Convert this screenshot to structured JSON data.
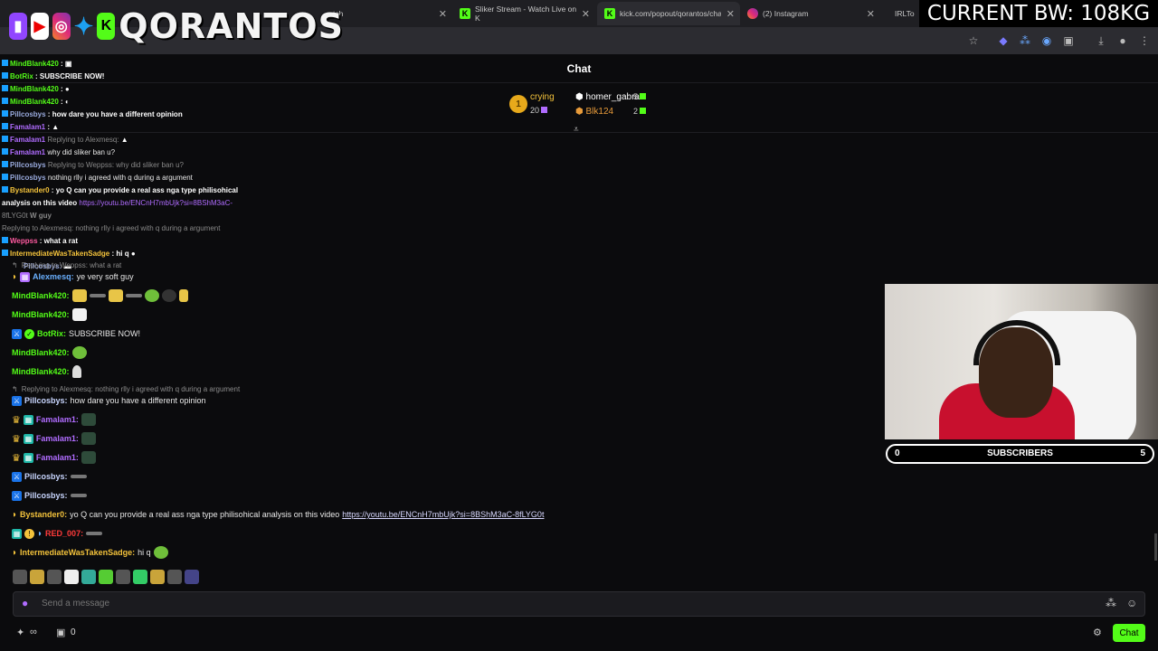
{
  "browser": {
    "tabs": [
      {
        "label": "tch",
        "favicon": "twitch-icon"
      },
      {
        "label": "Sliker Stream - Watch Live on K",
        "favicon": "kick-icon"
      },
      {
        "label": "kick.com/popout/qorantos/cha",
        "favicon": "kick-icon"
      },
      {
        "label": "(2) Instagram",
        "favicon": "instagram-icon"
      },
      {
        "label": "IRLTo",
        "favicon": "irl-icon"
      }
    ]
  },
  "overlay": {
    "channel_name": "QORANTOS",
    "bw_banner": "CURRENT BW: 108KG",
    "small_chat": [
      {
        "user": "MindBlank420",
        "text": ""
      },
      {
        "user": "BotRix",
        "text": "SUBSCRIBE NOW!"
      },
      {
        "user": "MindBlank420",
        "text": ""
      },
      {
        "user": "MindBlank420",
        "text": ""
      },
      {
        "user": "Pillcosbys",
        "text": "how dare you have a different opinion"
      },
      {
        "user": "Famalam1",
        "text": ""
      },
      {
        "user": "Famalam1",
        "text": ""
      },
      {
        "user": "Famalam1",
        "text": ""
      },
      {
        "user": "Pillcosbys",
        "text": ""
      },
      {
        "user": "Pillcosbys",
        "text": ""
      },
      {
        "user": "Bystander0",
        "text": "yo Q can you provide a real ass nga type philisohical"
      },
      {
        "user": "",
        "text": "W guy"
      },
      {
        "user": "",
        "text": ""
      },
      {
        "user": "IntermediateWasTakenSadge",
        "text": "hi q"
      }
    ]
  },
  "chat": {
    "title": "Chat",
    "leaderboard": {
      "first_place": "1",
      "first_name": "crying",
      "first_count": "20",
      "second_name": "homer_gabra",
      "second_count": "5",
      "third_name": "Blk124",
      "third_count": "2"
    },
    "stale_lines": {
      "reply1": "Replying to Alexmesq:",
      "weppss": "Weppss",
      "weppss_text": "why did sliker ban u?",
      "reply2": "Replying to Weppss: why did sliker ban u?",
      "alexmesq": "Alexmesq",
      "alexmesq_text": "nothing rlly i agreed with q during a argument",
      "analysis": "analysis on this video",
      "link_short": "https://youtu.be/ENCnH7mbUjk?si=8BShM3aC-",
      "link_tail": "8fLYG0t",
      "reply3": "Replying to Alexmesq: nothing rlly i agreed with q during a argument",
      "weppss2_text": "what a rat",
      "pillcosbys": "Pillcosbys:"
    },
    "messages": {
      "reply_weppss": "Replying to Weppss: what a rat",
      "alex_user": "Alexmesq:",
      "alex_text": "ye very soft guy",
      "mind_user": "MindBlank420:",
      "botrix_user": "BotRix:",
      "botrix_text": "SUBSCRIBE NOW!",
      "reply_alex": "Replying to Alexmesq: nothing rlly i agreed with q during a argument",
      "pill_user": "Pillcosbys:",
      "pill_text": "how dare you have a different opinion",
      "fam_user": "Famalam1:",
      "bystander_user": "Bystander0:",
      "bystander_text": "yo Q can you provide a real ass nga type philisohical analysis on this video",
      "bystander_link": "https://youtu.be/ENCnH7mbUjk?si=8BShM3aC-8fLYG0t",
      "red_user": "RED_007:",
      "inter_user": "IntermediateWasTakenSadge:",
      "inter_text": "hi q"
    },
    "input_placeholder": "Send a message",
    "footer": {
      "points_left": "0",
      "points_right": "0",
      "send_label": "Chat"
    }
  },
  "webcam": {
    "sub_left": "0",
    "sub_label": "SUBSCRIBERS",
    "sub_right": "5"
  },
  "colors": {
    "kick_green": "#53fc18",
    "purple": "#b06cff",
    "gold": "#f3c23b",
    "background": "#0b0b0d"
  }
}
